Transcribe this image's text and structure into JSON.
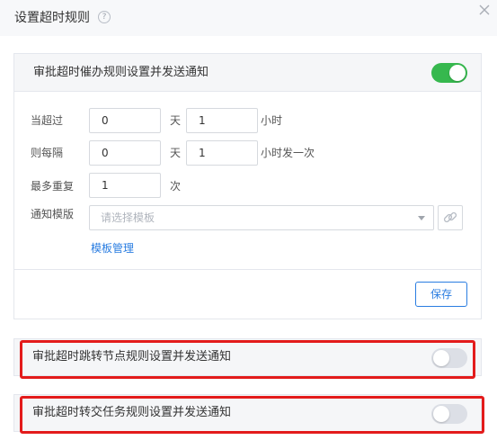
{
  "dialog": {
    "title": "设置超时规则",
    "help_icon": "question-circle-icon",
    "close_icon": "close-icon"
  },
  "rule_main": {
    "title": "审批超时催办规则设置并发送通知",
    "enabled": true,
    "rows": {
      "exceed": {
        "label": "当超过",
        "days": "0",
        "days_unit": "天",
        "hours": "1",
        "hours_unit": "小时"
      },
      "interval": {
        "label": "则每隔",
        "days": "0",
        "days_unit": "天",
        "hours": "1",
        "hours_unit": "小时发一次"
      },
      "repeat": {
        "label": "最多重复",
        "count": "1",
        "count_unit": "次"
      },
      "template": {
        "label": "通知模版",
        "placeholder": "请选择模板",
        "link_icon": "link-icon"
      }
    },
    "manage_link": "模板管理",
    "save_label": "保存"
  },
  "rule_jump": {
    "title": "审批超时跳转节点规则设置并发送通知",
    "enabled": false
  },
  "rule_transfer": {
    "title": "审批超时转交任务规则设置并发送通知",
    "enabled": false
  },
  "colors": {
    "accent": "#2a7de1",
    "toggle_on": "#36b84e",
    "toggle_off": "#dcdfe6",
    "highlight": "#e31b1b"
  }
}
